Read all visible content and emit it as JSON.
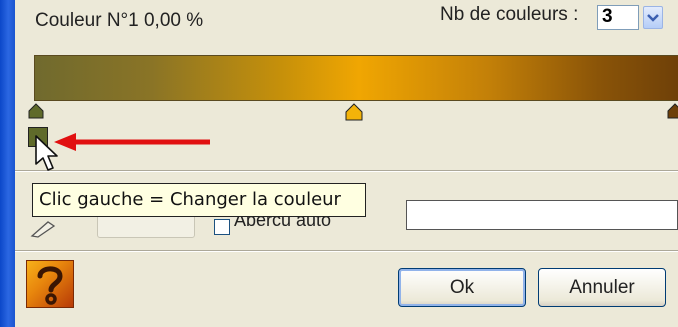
{
  "header": {
    "color_label": "Couleur N°1 0,00 %",
    "nb_label": "Nb de couleurs :",
    "nb_value": "3"
  },
  "tooltip": {
    "text": "Clic gauche = Changer la couleur"
  },
  "options": {
    "apercu_label": "Aperçu auto"
  },
  "buttons": {
    "ok_label": "Ok",
    "cancel_label": "Annuler"
  },
  "colors": {
    "gradient_start": "#706a2e",
    "gradient_mid": "#f0a602",
    "gradient_end": "#6d3f08",
    "stop1_swatch": "#5f6a2a",
    "arrow": "#e11010",
    "tooltip_bg": "#ffffe1"
  },
  "icons": {
    "help": "question-mark-icon",
    "pen": "pencil-icon",
    "pointer": "mouse-pointer-icon"
  }
}
